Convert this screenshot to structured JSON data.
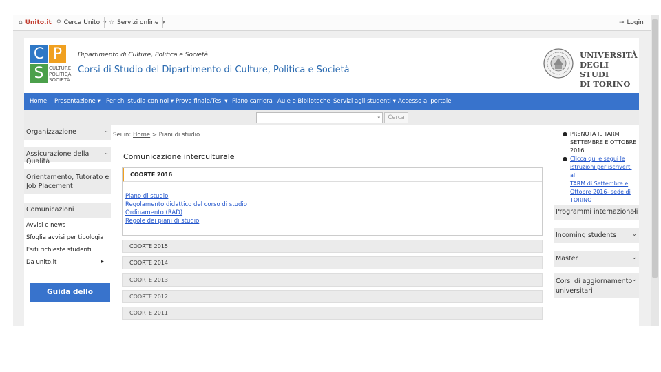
{
  "topbar": {
    "unito": "Unito.it",
    "cerca": "Cerca Unito",
    "servizi": "Servizi online",
    "login": "Login"
  },
  "brand": {
    "tile_c": "C",
    "tile_p": "P",
    "tile_s": "S",
    "cps_words": [
      "CULTURE",
      "POLITICA",
      "SOCIETÀ"
    ],
    "dept": "Dipartimento di Culture, Politica e Società",
    "courses": "Corsi di Studio del Dipartimento di Culture, Politica e Società",
    "university": [
      "UNIVERSITÀ",
      "DEGLI STUDI",
      "DI TORINO"
    ]
  },
  "nav": [
    {
      "label": "Home",
      "dropdown": false
    },
    {
      "label": "Presentazione",
      "dropdown": true
    },
    {
      "label": "Per chi studia con noi",
      "dropdown": true
    },
    {
      "label": "Prova finale/Tesi",
      "dropdown": true
    },
    {
      "label": "Piano carriera",
      "dropdown": false
    },
    {
      "label": "Aule e Biblioteche",
      "dropdown": false
    },
    {
      "label": "Servizi agli studenti",
      "dropdown": true
    },
    {
      "label": "Accesso al portale",
      "dropdown": false
    }
  ],
  "search": {
    "button": "Cerca"
  },
  "left": {
    "organizzazione": "Organizzazione",
    "assicurazione": "Assicurazione della Qualità",
    "orientamento": [
      "Orientamento, Tutorato e",
      "Job Placement"
    ],
    "comunicazioni": "Comunicazioni",
    "links": [
      "Avvisi e news",
      "Sfoglia avvisi per tipologia",
      "Esiti richieste studenti",
      "Da unito.it"
    ],
    "guida": "Guida dello studente"
  },
  "main": {
    "crumb_prefix": "Sei in:",
    "crumb_home": "Home",
    "crumb_rest": "> Piani di studio",
    "title": "Comunicazione interculturale",
    "active_cohort": "COORTE 2016",
    "links": [
      "Piano di studio",
      "Regolamento didattico del corso di studio",
      "Ordinamento (RAD)",
      "Regole dei piani di studio"
    ],
    "cohorts": [
      "COORTE 2015",
      "COORTE 2014",
      "COORTE 2013",
      "COORTE 2012",
      "COORTE 2011"
    ]
  },
  "right": {
    "news1": [
      "PRENOTA IL TARM",
      "SETTEMBRE E OTTOBRE",
      "2016"
    ],
    "news2": [
      "Clicca qui e segui le",
      "istruzioni per iscriverti al",
      "TARM di Settembre e",
      "Ottobre 2016- sede di",
      "TORINO"
    ],
    "programmi": "Programmi internazionali",
    "incoming": "Incoming students",
    "master": "Master",
    "corsi": [
      "Corsi di aggiornamento",
      "universitari"
    ]
  },
  "colors": {
    "nav_blue": "#3873cc",
    "link_blue": "#2255cc",
    "accent_orange": "#f0a020"
  }
}
